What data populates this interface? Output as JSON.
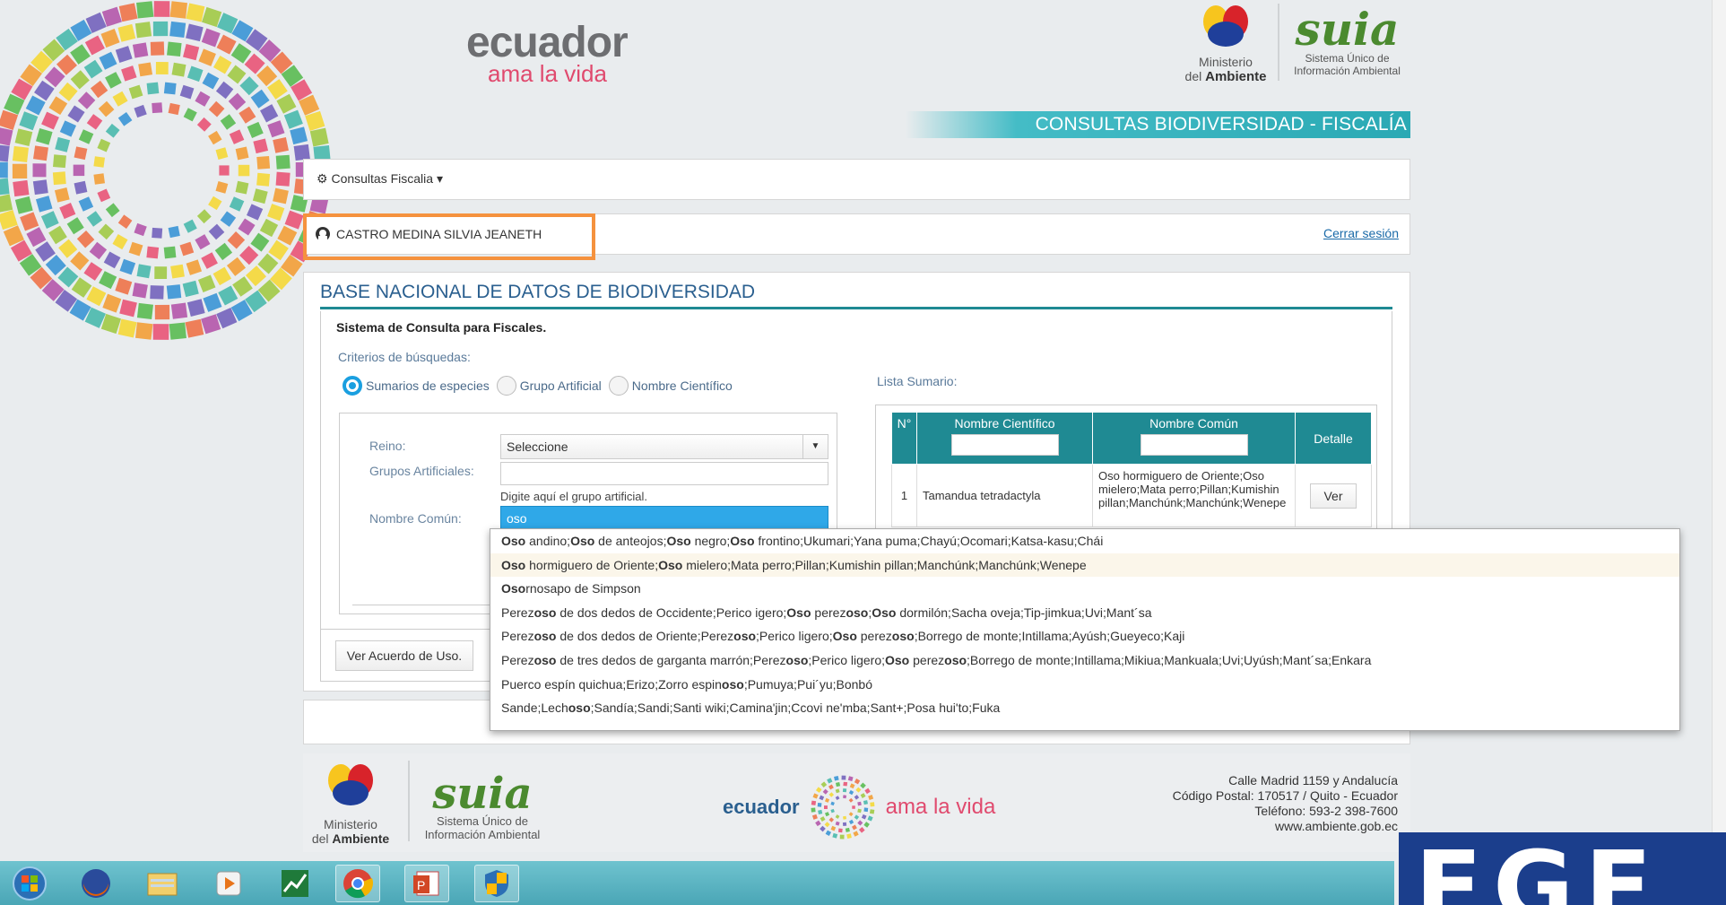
{
  "header": {
    "ecuador_main": "ecuador",
    "ecuador_tag": "ama la vida",
    "ministerio_line1": "Ministerio",
    "ministerio_line2_pre": "del",
    "ministerio_line2_bold": "Ambiente",
    "suia_mark": "suia",
    "suia_line1": "Sistema Único de",
    "suia_line2": "Información Ambiental",
    "banner": "CONSULTAS BIODIVERSIDAD - FISCALÍA"
  },
  "menu": {
    "item_label": "Consultas Fiscalia"
  },
  "user": {
    "name": "CASTRO MEDINA SILVIA JEANETH",
    "logout": "Cerrar sesión"
  },
  "main": {
    "title": "BASE NACIONAL DE DATOS DE BIODIVERSIDAD",
    "subtitle": "Sistema de Consulta para Fiscales.",
    "criteria_label": "Criterios de búsquedas:",
    "radios": [
      {
        "label": "Sumarios de especies",
        "selected": true
      },
      {
        "label": "Grupo Artificial",
        "selected": false
      },
      {
        "label": "Nombre Científico",
        "selected": false
      }
    ],
    "lista_label": "Lista Sumario:",
    "form": {
      "reino_label": "Reino:",
      "reino_value": "Seleccione",
      "grupos_label": "Grupos Artificiales:",
      "grupos_hint": "Digite aquí el grupo artificial.",
      "nombre_label": "Nombre Común:",
      "nombre_value": "oso"
    },
    "table": {
      "headers": [
        "N°",
        "Nombre Científico",
        "Nombre Común",
        "Detalle"
      ],
      "rows": [
        {
          "n": "1",
          "cientifico": "Tamandua tetradactyla",
          "comun": "Oso hormiguero de Oriente;Oso mielero;Mata perro;Pillan;Kumishin pillan;Manchúnk;Manchúnk;Wenepe",
          "detalle": "Ver"
        }
      ]
    },
    "acuerdo_button": "Ver Acuerdo de Uso."
  },
  "autocomplete": {
    "options": [
      "Oso andino;Oso de anteojos;Oso negro;Oso frontino;Ukumari;Yana puma;Chayú;Ocomari;Katsa-kasu;Chái",
      "Oso hormiguero de Oriente;Oso mielero;Mata perro;Pillan;Kumishin pillan;Manchúnk;Manchúnk;Wenepe",
      "Osornosapo de Simpson",
      "Perezoso de dos dedos de Occidente;Perico igero;Oso perezoso;Oso dormilón;Sacha oveja;Tip-jimkua;Uvi;Mant´sa",
      "Perezoso de dos dedos de Oriente;Perezoso;Perico ligero;Oso perezoso;Borrego de monte;Intillama;Ayúsh;Gueyeco;Kaji",
      "Perezoso de tres dedos de garganta marrón;Perezoso;Perico ligero;Oso perezoso;Borrego de monte;Intillama;Mikiua;Mankuala;Uvi;Uyúsh;Mant´sa;Enkara",
      "Puerco espín quichua;Erizo;Zorro espinoso;Pumuya;Pui´yu;Bonbó",
      "Sande;Lechoso;Sandía;Sandi;Santi wiki;Camina'jin;Ccovi ne'mba;Sant+;Posa hui'to;Fuka"
    ],
    "highlighted_index": 1
  },
  "footer": {
    "ministerio_line1": "Ministerio",
    "ministerio_line2_pre": "del",
    "ministerio_line2_bold": "Ambiente",
    "suia_mark": "suia",
    "suia_line1": "Sistema Único de",
    "suia_line2": "Información Ambiental",
    "ecuador_main": "ecuador",
    "ecuador_tag": "ama la vida",
    "address": [
      "Calle Madrid 1159 y Andalucía",
      "Código Postal: 170517 / Quito - Ecuador",
      "Teléfono: 593-2 398-7600",
      "www.ambiente.gob.ec"
    ]
  },
  "taskbar": {
    "icons": [
      "start-orb-icon",
      "firefox-icon",
      "file-explorer-icon",
      "media-player-icon",
      "stock-chart-icon",
      "chrome-icon",
      "powerpoint-icon",
      "security-shield-icon"
    ]
  },
  "corner_logo": "EGE",
  "colors": {
    "accent_teal": "#1f8a93",
    "title_blue": "#2a5f8f",
    "highlight_orange": "#f5923e",
    "selected_blue": "#2fa8e8"
  }
}
